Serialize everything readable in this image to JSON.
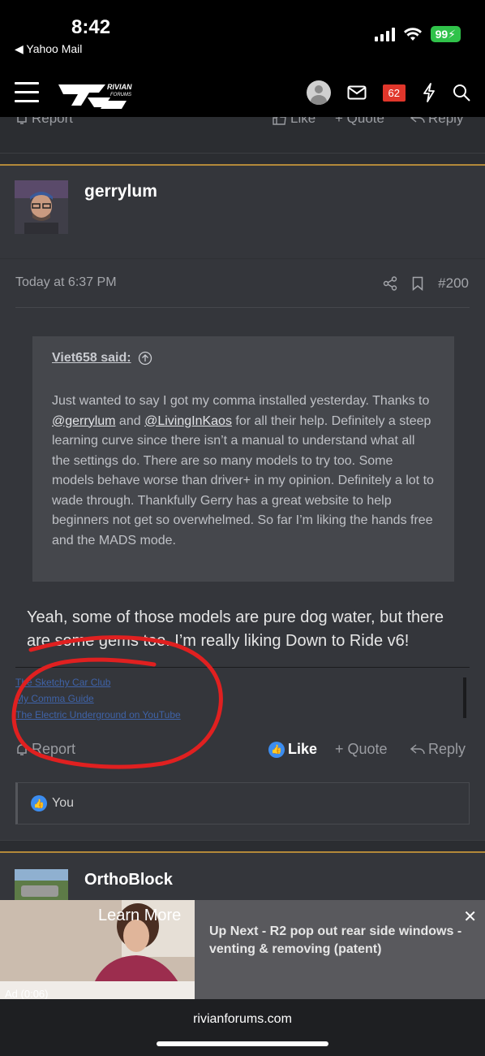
{
  "status_bar": {
    "time": "8:42",
    "back_app": "◀ Yahoo Mail",
    "battery": "99"
  },
  "nav": {
    "notification_count": "62",
    "logo_text": "RIVIAN FORUMS"
  },
  "prev_post_actions": {
    "report": "Report",
    "like": "Like",
    "quote": "+ Quote",
    "reply": "Reply"
  },
  "post": {
    "username": "gerrylum",
    "timestamp": "Today at 6:37 PM",
    "post_number": "#200",
    "quote": {
      "author": "Viet658 said:",
      "line1": "Just wanted to say I got my comma installed yesterday.",
      "line2_pre": "Thanks to ",
      "mention1": "@gerrylum",
      "line2_mid": " and ",
      "mention2": "@LivingInKaos",
      "line2_post": " for all their help.",
      "line3": "Definitely a steep learning curve since there isn’t a manual to understand what all the settings do. There are so many models to try too. Some models behave worse than driver+ in my opinion. Definitely a lot to wade through. Thankfully Gerry has a great website to help beginners not get so overwhelmed. So far I’m liking the hands free and the MADS mode."
    },
    "reply_text": "Yeah, some of those models are pure dog water, but there are some gems too. I’m really liking Down to Ride v6!",
    "signature_links": [
      "The Sketchy Car Club",
      "My Comma Guide",
      "The Electric Underground on YouTube"
    ],
    "actions": {
      "report": "Report",
      "like": "Like",
      "quote": "+ Quote",
      "reply": "Reply"
    },
    "reactions_text": "You"
  },
  "next_post": {
    "username": "OrthoBlock"
  },
  "ad": {
    "cta": "Learn More",
    "label": "Ad",
    "timer": "(0:06)",
    "headline": "Up Next - R2 pop out rear side windows - venting & removing (patent)"
  },
  "browser": {
    "url": "rivianforums.com"
  }
}
